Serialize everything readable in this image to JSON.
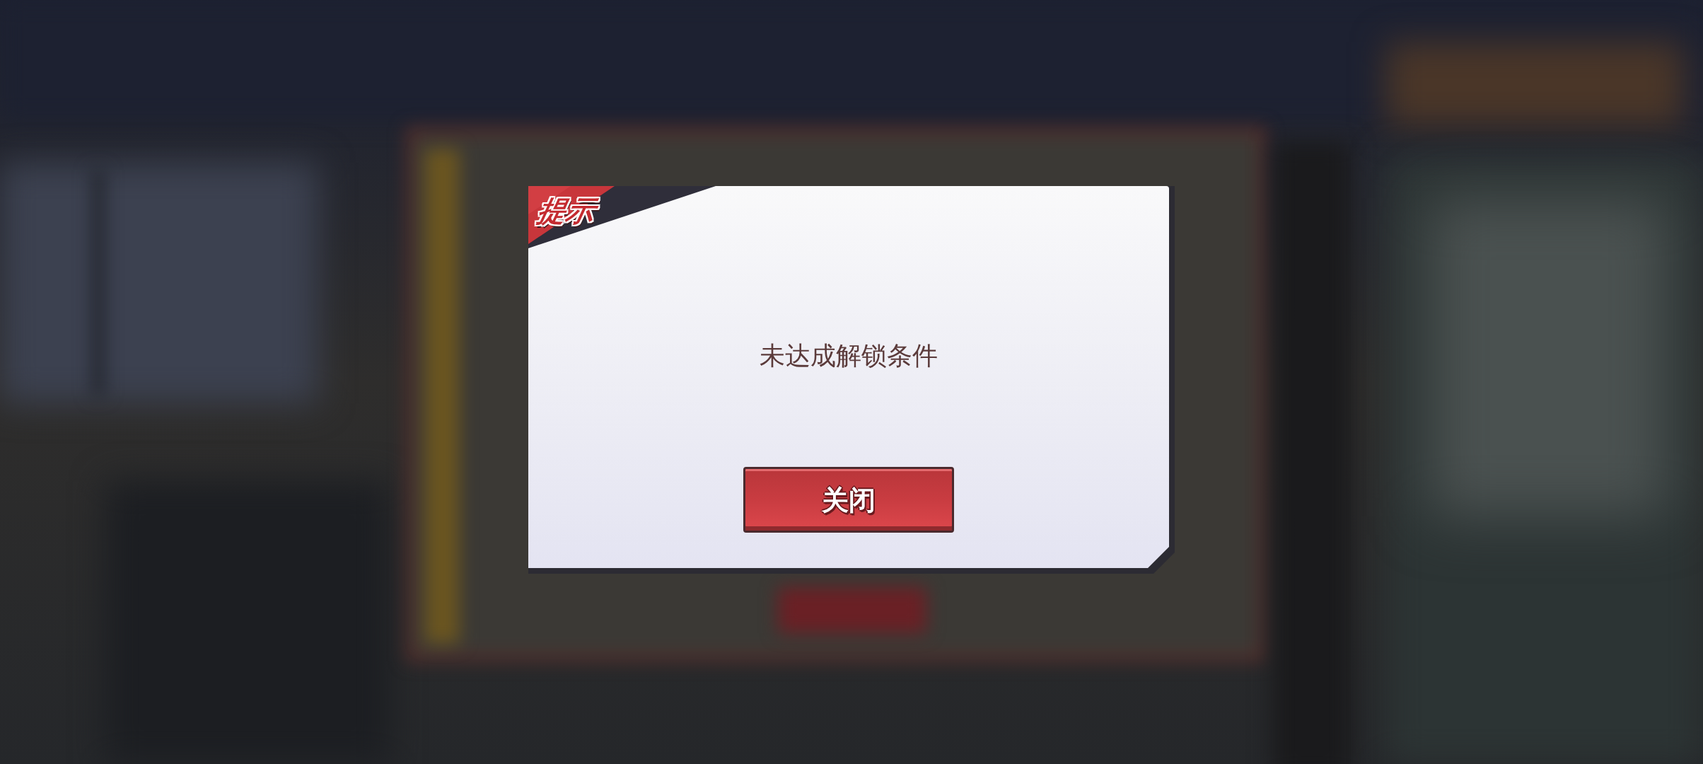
{
  "dialog": {
    "title": "提示",
    "message": "未达成解锁条件",
    "buttons": [
      {
        "label": "关闭",
        "kind": "primary"
      }
    ]
  }
}
